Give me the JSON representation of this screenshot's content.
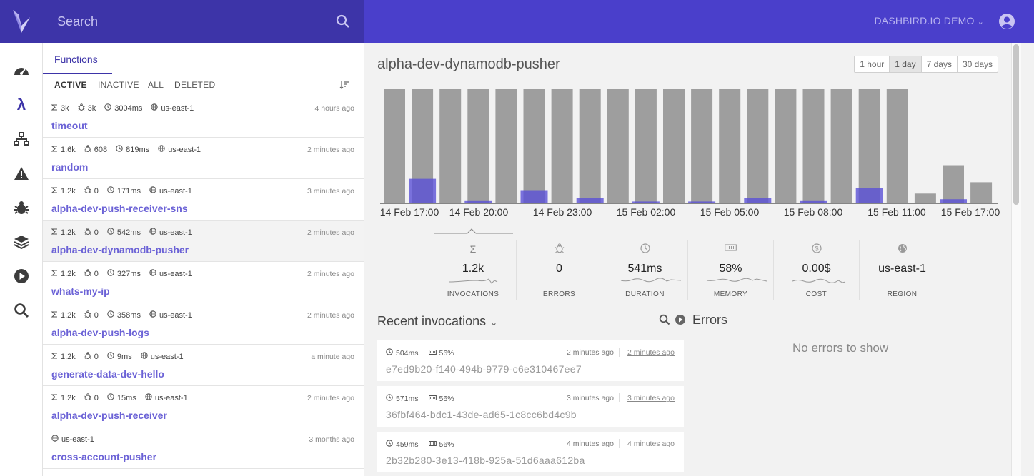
{
  "header": {
    "search_placeholder": "Search",
    "account_label": "DASHBIRD.IO DEMO",
    "brand_color": "#4a3fcb",
    "brand_dark": "#3d34a8"
  },
  "rail": {
    "items": [
      "dashboard-icon",
      "lambda-icon",
      "network-icon",
      "warning-icon",
      "bug-icon",
      "layers-icon",
      "play-icon",
      "search-icon"
    ]
  },
  "functions": {
    "tab_label": "Functions",
    "filters": [
      "ACTIVE",
      "INACTIVE",
      "ALL",
      "DELETED"
    ],
    "active_filter": "ACTIVE",
    "items": [
      {
        "invocations": "3k",
        "errors": "3k",
        "duration": "3004ms",
        "region": "us-east-1",
        "time": "4 hours ago",
        "name": "timeout"
      },
      {
        "invocations": "1.6k",
        "errors": "608",
        "duration": "819ms",
        "region": "us-east-1",
        "time": "2 minutes ago",
        "name": "random"
      },
      {
        "invocations": "1.2k",
        "errors": "0",
        "duration": "171ms",
        "region": "us-east-1",
        "time": "3 minutes ago",
        "name": "alpha-dev-push-receiver-sns"
      },
      {
        "invocations": "1.2k",
        "errors": "0",
        "duration": "542ms",
        "region": "us-east-1",
        "time": "2 minutes ago",
        "name": "alpha-dev-dynamodb-pusher"
      },
      {
        "invocations": "1.2k",
        "errors": "0",
        "duration": "327ms",
        "region": "us-east-1",
        "time": "2 minutes ago",
        "name": "whats-my-ip"
      },
      {
        "invocations": "1.2k",
        "errors": "0",
        "duration": "358ms",
        "region": "us-east-1",
        "time": "2 minutes ago",
        "name": "alpha-dev-push-logs"
      },
      {
        "invocations": "1.2k",
        "errors": "0",
        "duration": "9ms",
        "region": "us-east-1",
        "time": "a minute ago",
        "name": "generate-data-dev-hello"
      },
      {
        "invocations": "1.2k",
        "errors": "0",
        "duration": "15ms",
        "region": "us-east-1",
        "time": "2 minutes ago",
        "name": "alpha-dev-push-receiver"
      },
      {
        "invocations": "",
        "errors": "",
        "duration": "",
        "region": "us-east-1",
        "time": "3 months ago",
        "name": "cross-account-pusher"
      }
    ],
    "selected_index": 3
  },
  "main": {
    "title": "alpha-dev-dynamodb-pusher",
    "ranges": [
      "1 hour",
      "1 day",
      "7 days",
      "30 days"
    ],
    "active_range": "1 day",
    "metrics": [
      {
        "icon": "sigma-icon",
        "value": "1.2k",
        "label": "INVOCATIONS"
      },
      {
        "icon": "bug-icon",
        "value": "0",
        "label": "ERRORS"
      },
      {
        "icon": "clock-icon",
        "value": "541ms",
        "label": "DURATION"
      },
      {
        "icon": "memory-icon",
        "value": "58%",
        "label": "MEMORY"
      },
      {
        "icon": "dollar-icon",
        "value": "0.00$",
        "label": "COST"
      },
      {
        "icon": "globe-icon",
        "value": "us-east-1",
        "label": "REGION"
      }
    ],
    "recent_title": "Recent invocations",
    "invocations": [
      {
        "duration": "504ms",
        "memory": "56%",
        "time": "2 minutes ago",
        "time_link": "2 minutes ago",
        "id": "e7ed9b20-f140-494b-9779-c6e310467ee7"
      },
      {
        "duration": "571ms",
        "memory": "56%",
        "time": "3 minutes ago",
        "time_link": "3 minutes ago",
        "id": "36fbf464-bdc1-43de-ad65-1c8cc6bd4c9b"
      },
      {
        "duration": "459ms",
        "memory": "56%",
        "time": "4 minutes ago",
        "time_link": "4 minutes ago",
        "id": "2b32b280-3e13-418b-925a-51d6aaa612ba"
      }
    ],
    "errors_title": "Errors",
    "no_errors": "No errors to show"
  },
  "chart_data": {
    "type": "bar",
    "x_ticks": [
      "14 Feb 17:00",
      "14 Feb 20:00",
      "14 Feb 23:00",
      "15 Feb 02:00",
      "15 Feb 05:00",
      "15 Feb 08:00",
      "15 Feb 11:00",
      "15 Feb 17:00"
    ],
    "series": [
      {
        "values": [
          100,
          100,
          100,
          100,
          100,
          100,
          100,
          100,
          100,
          100,
          100,
          100,
          100,
          100,
          100,
          100,
          100,
          100,
          100,
          8,
          33,
          18
        ],
        "color": "#9e9e9e"
      },
      {
        "values": [
          0,
          21,
          0,
          2,
          0,
          11,
          0,
          4,
          0,
          1,
          0,
          1,
          0,
          4,
          0,
          2,
          0,
          13,
          0,
          0,
          3,
          0
        ],
        "color": "#5a50d6"
      }
    ],
    "ylim": [
      0,
      100
    ]
  }
}
